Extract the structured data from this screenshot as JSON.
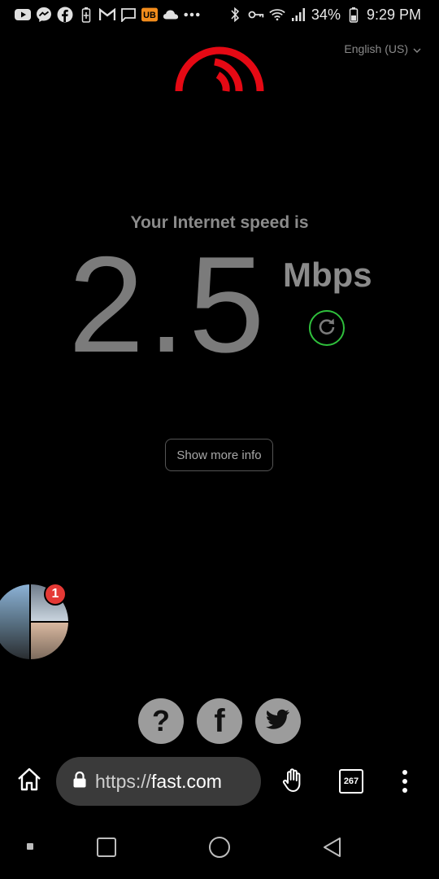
{
  "status_bar": {
    "battery_percent": "34%",
    "time": "9:29 PM",
    "left_icons": [
      "youtube-icon",
      "messenger-icon",
      "facebook-icon",
      "battery-saver-icon",
      "gmail-icon",
      "message-icon",
      "ub-icon",
      "cloud-icon",
      "more-dots-icon"
    ],
    "right_icons": [
      "bluetooth-icon",
      "key-icon",
      "wifi-icon",
      "signal-icon",
      "battery-icon"
    ]
  },
  "language": {
    "selected": "English (US)"
  },
  "speed": {
    "label": "Your Internet speed is",
    "value": "2.5",
    "unit": "Mbps"
  },
  "more_info_button": {
    "label": "Show more info"
  },
  "chat_head": {
    "badge_count": "1"
  },
  "social": {
    "help": "?",
    "facebook": "f",
    "twitter_icon": "twitter-icon"
  },
  "browser": {
    "url_scheme": "https://",
    "url_host": "fast.com",
    "tab_count": "267"
  },
  "colors": {
    "logo_red": "#e50914",
    "refresh_green": "#2fbf3c",
    "badge_red": "#e53935"
  }
}
